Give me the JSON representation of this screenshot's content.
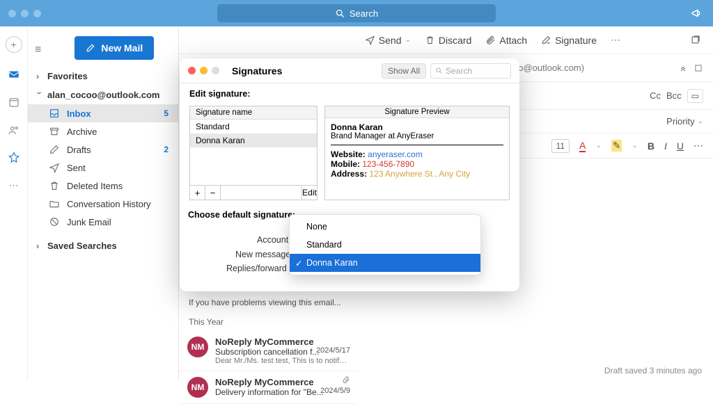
{
  "titlebar": {
    "search_placeholder": "Search"
  },
  "newmail_label": "New Mail",
  "nav": {
    "favorites": "Favorites",
    "account": "alan_cocoo@outlook.com",
    "inbox": "Inbox",
    "inbox_count": "5",
    "archive": "Archive",
    "drafts": "Drafts",
    "drafts_count": "2",
    "sent": "Sent",
    "deleted": "Deleted Items",
    "conv": "Conversation History",
    "junk": "Junk Email",
    "saved": "Saved Searches"
  },
  "cmdbar": {
    "send": "Send",
    "discard": "Discard",
    "attach": "Attach",
    "signature": "Signature"
  },
  "compose": {
    "to_email": "oo@outlook.com)",
    "cc": "Cc",
    "bcc": "Bcc",
    "priority": "Priority",
    "fontsize": "11"
  },
  "maillist": {
    "problems": "If you have problems viewing this email...",
    "year_header": "This Year",
    "items": [
      {
        "initials": "NM",
        "from": "NoReply MyCommerce",
        "subject": "Subscription cancellation f...",
        "date": "2024/5/17",
        "preview": "Dear Mr./Ms. test test, This is to notify...",
        "has_attach": false
      },
      {
        "initials": "NM",
        "from": "NoReply MyCommerce",
        "subject": "Delivery information for \"Be...",
        "date": "2024/5/9",
        "preview": "",
        "has_attach": true
      }
    ]
  },
  "dialog": {
    "title": "Signatures",
    "show_all": "Show All",
    "search_placeholder": "Search",
    "edit_label": "Edit signature:",
    "sig_header": "Signature name",
    "sig_names": [
      "Standard",
      "Donna Karan"
    ],
    "edit_btn": "Edit",
    "preview_header": "Signature Preview",
    "preview": {
      "name": "Donna Karan",
      "title": "Brand Manager at AnyEraser",
      "website_label": "Website:",
      "website_val": "anyeraser.com",
      "mobile_label": "Mobile:",
      "mobile_val": "123-456-7890",
      "address_label": "Address:",
      "address_val": "123 Anywhere St., Any City"
    },
    "choose_label": "Choose default signature:",
    "account_label": "Account",
    "newmsg_label": "New messages",
    "repfwd_label": "Replies/forward"
  },
  "dropdown": {
    "options": [
      "None",
      "Standard",
      "Donna Karan"
    ],
    "selected": "Donna Karan"
  },
  "status": {
    "draft": "Draft saved 3 minutes ago"
  }
}
